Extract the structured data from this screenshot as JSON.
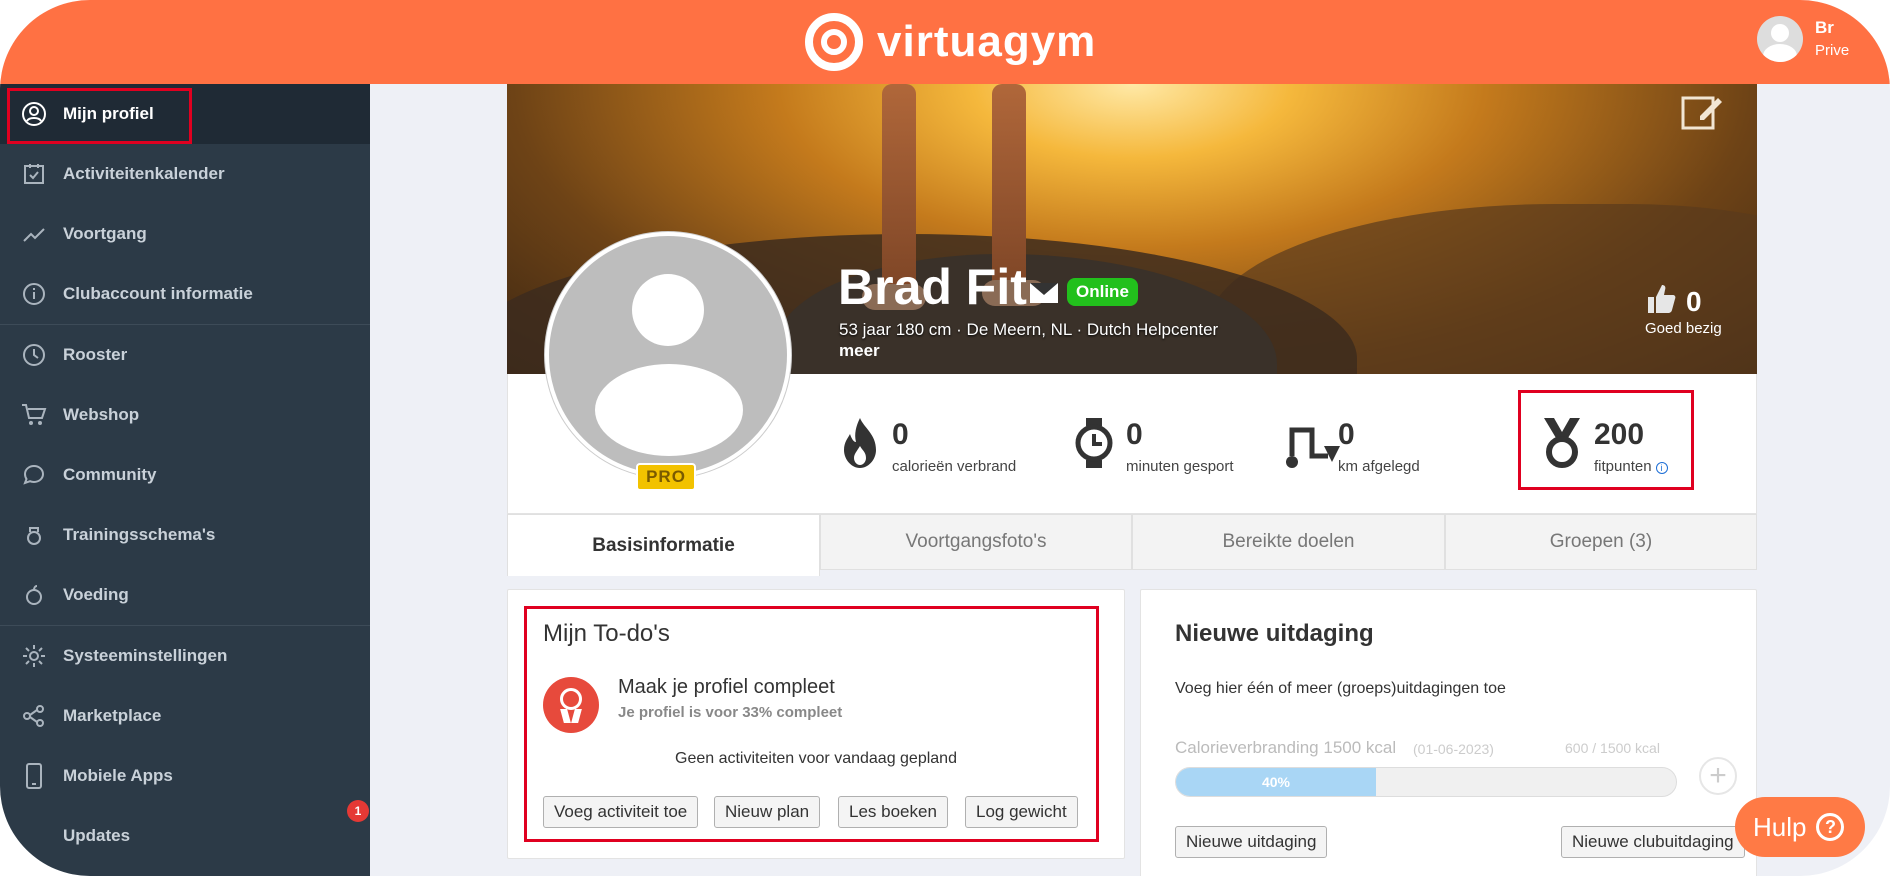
{
  "header": {
    "logo_text": "virtuagym",
    "user_name": "Br",
    "user_sub": "Prive"
  },
  "sidebar": {
    "items": [
      {
        "label": "Mijn profiel",
        "icon": "user-circle-icon"
      },
      {
        "label": "Activiteitenkalender",
        "icon": "calendar-check-icon"
      },
      {
        "label": "Voortgang",
        "icon": "trend-line-icon"
      },
      {
        "label": "Clubaccount informatie",
        "icon": "info-icon"
      },
      {
        "label": "Rooster",
        "icon": "clock-icon"
      },
      {
        "label": "Webshop",
        "icon": "cart-icon"
      },
      {
        "label": "Community",
        "icon": "chat-bubble-icon"
      },
      {
        "label": "Trainingsschema's",
        "icon": "kettlebell-icon"
      },
      {
        "label": "Voeding",
        "icon": "apple-icon"
      },
      {
        "label": "Systeeminstellingen",
        "icon": "gear-icon"
      },
      {
        "label": "Marketplace",
        "icon": "share-icon"
      },
      {
        "label": "Mobiele Apps",
        "icon": "mobile-icon"
      },
      {
        "label": "Updates",
        "icon": "updates-icon"
      }
    ],
    "updates_badge": "1"
  },
  "profile": {
    "name": "Brad Fit",
    "status": "Online",
    "meta": "53 jaar 180 cm · De Meern, NL · Dutch Helpcenter",
    "more": "meer",
    "likes": "0",
    "likes_label": "Goed bezig",
    "pro_label": "PRO",
    "stats": [
      {
        "value": "0",
        "label": "calorieën verbrand",
        "icon": "flame-icon"
      },
      {
        "value": "0",
        "label": "minuten gesport",
        "icon": "stopwatch-icon"
      },
      {
        "value": "0",
        "label": "km afgelegd",
        "icon": "route-icon"
      },
      {
        "value": "200",
        "label": "fitpunten",
        "icon": "medal-icon"
      }
    ]
  },
  "tabs": [
    "Basisinformatie",
    "Voortgangsfoto's",
    "Bereikte doelen",
    "Groepen (3)"
  ],
  "todo": {
    "title": "Mijn To-do's",
    "item_title": "Maak je profiel compleet",
    "item_sub": "Je profiel is voor 33% compleet",
    "empty": "Geen activiteiten voor vandaag gepland",
    "buttons": [
      "Voeg activiteit toe",
      "Nieuw plan",
      "Les boeken",
      "Log gewicht"
    ]
  },
  "challenge": {
    "title": "Nieuwe uitdaging",
    "desc": "Voeg hier één of meer (groeps)uitdagingen toe",
    "name": "Calorieverbranding 1500 kcal",
    "date": "(01-06-2023)",
    "progress_text": "600 / 1500 kcal",
    "progress_percent": 40,
    "progress_label": "40%",
    "btn_new": "Nieuwe uitdaging",
    "btn_club": "Nieuwe clubuitdaging"
  },
  "help": {
    "label": "Hulp"
  },
  "colors": {
    "brand": "#ff7143",
    "sidebar": "#2c3a47",
    "online": "#22c01c",
    "highlight": "#e00020"
  }
}
